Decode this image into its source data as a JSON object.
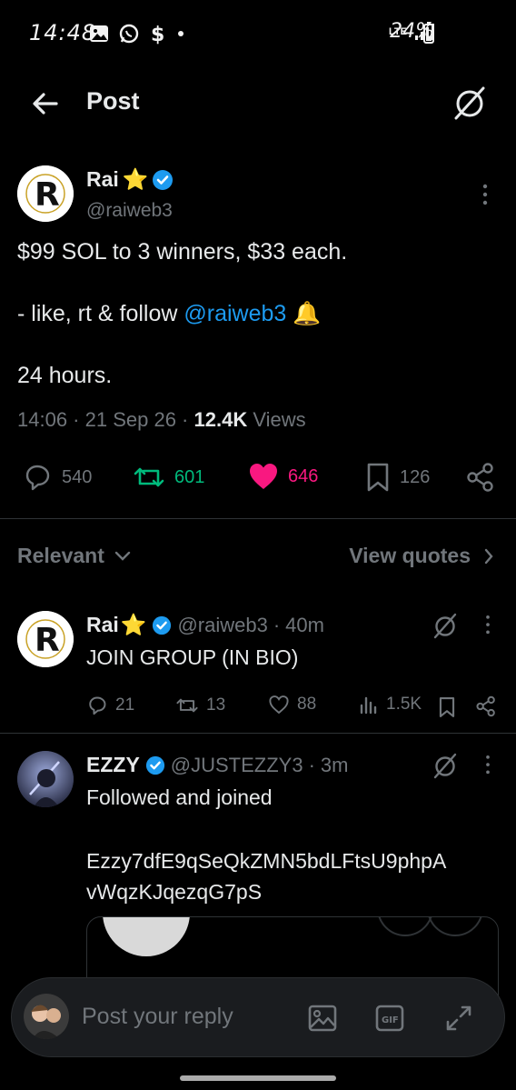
{
  "status_bar": {
    "time": "14:48",
    "network": "LTE",
    "battery": "24%"
  },
  "header": {
    "title": "Post"
  },
  "post": {
    "author_name": "Rai",
    "author_emoji": "⭐",
    "author_handle": "@raiweb3",
    "text_line1": "$99 SOL to 3 winners, $33 each.",
    "text_line2_prefix": "- like, rt & follow ",
    "text_line2_mention": "@raiweb3",
    "text_line2_emoji": "🔔",
    "text_line3": "24 hours.",
    "time": "14:06",
    "date": "21 Sep 26",
    "views_count": "12.4K",
    "views_label": "Views",
    "replies": "540",
    "retweets": "601",
    "likes": "646",
    "bookmarks": "126"
  },
  "sort": {
    "label": "Relevant",
    "view_quotes": "View quotes"
  },
  "replies": [
    {
      "name": "Rai",
      "emoji": "⭐",
      "handle": "@raiweb3",
      "time": "40m",
      "text": "JOIN GROUP (IN BIO)",
      "reply_count": "21",
      "retweet_count": "13",
      "like_count": "88",
      "view_count": "1.5K"
    },
    {
      "name": "EZZY",
      "handle": "@JUSTEZZY3",
      "time": "3m",
      "text_line1": "Followed and joined",
      "text_line2": "Ezzy7dfE9qSeQkZMN5bdLFtsU9phpA",
      "text_line3": "vWqzKJqezqG7pS"
    }
  ],
  "compose": {
    "placeholder": "Post your reply"
  },
  "colors": {
    "background": "#000000",
    "text": "#e7e9ea",
    "muted": "#71767b",
    "accent_blue": "#1d9bf0",
    "retweet_green": "#00ba7c",
    "like_pink": "#f91880",
    "verified_blue": "#1d9bf0"
  }
}
